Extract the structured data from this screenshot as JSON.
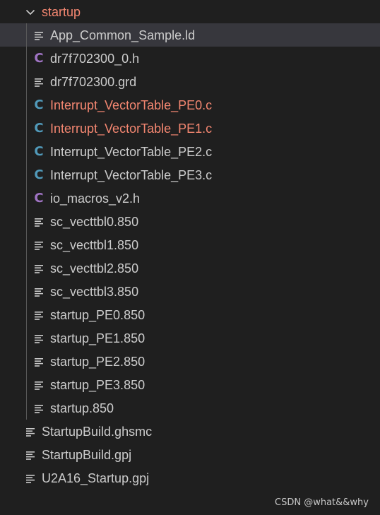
{
  "folder": {
    "name": "startup",
    "expanded": true,
    "label_color": "#f48771"
  },
  "files": [
    {
      "name": "App_Common_Sample.ld",
      "icon": "lines-icon",
      "selected": true
    },
    {
      "name": "dr7f702300_0.h",
      "icon": "c-header-icon",
      "glyph": "C",
      "color": "#a074c4"
    },
    {
      "name": "dr7f702300.grd",
      "icon": "lines-icon"
    },
    {
      "name": "Interrupt_VectorTable_PE0.c",
      "icon": "c-source-icon",
      "glyph": "C",
      "color": "#519aba",
      "status": "error"
    },
    {
      "name": "Interrupt_VectorTable_PE1.c",
      "icon": "c-source-icon",
      "glyph": "C",
      "color": "#519aba",
      "status": "error"
    },
    {
      "name": "Interrupt_VectorTable_PE2.c",
      "icon": "c-source-icon",
      "glyph": "C",
      "color": "#519aba"
    },
    {
      "name": "Interrupt_VectorTable_PE3.c",
      "icon": "c-source-icon",
      "glyph": "C",
      "color": "#519aba"
    },
    {
      "name": "io_macros_v2.h",
      "icon": "c-header-icon",
      "glyph": "C",
      "color": "#a074c4"
    },
    {
      "name": "sc_vecttbl0.850",
      "icon": "lines-icon"
    },
    {
      "name": "sc_vecttbl1.850",
      "icon": "lines-icon"
    },
    {
      "name": "sc_vecttbl2.850",
      "icon": "lines-icon"
    },
    {
      "name": "sc_vecttbl3.850",
      "icon": "lines-icon"
    },
    {
      "name": "startup_PE0.850",
      "icon": "lines-icon"
    },
    {
      "name": "startup_PE1.850",
      "icon": "lines-icon"
    },
    {
      "name": "startup_PE2.850",
      "icon": "lines-icon"
    },
    {
      "name": "startup_PE3.850",
      "icon": "lines-icon"
    },
    {
      "name": "startup.850",
      "icon": "lines-icon"
    }
  ],
  "root_files": [
    {
      "name": "StartupBuild.ghsmc",
      "icon": "lines-icon"
    },
    {
      "name": "StartupBuild.gpj",
      "icon": "lines-icon"
    },
    {
      "name": "U2A16_Startup.gpj",
      "icon": "lines-icon"
    }
  ],
  "watermark": "CSDN @what&&why"
}
